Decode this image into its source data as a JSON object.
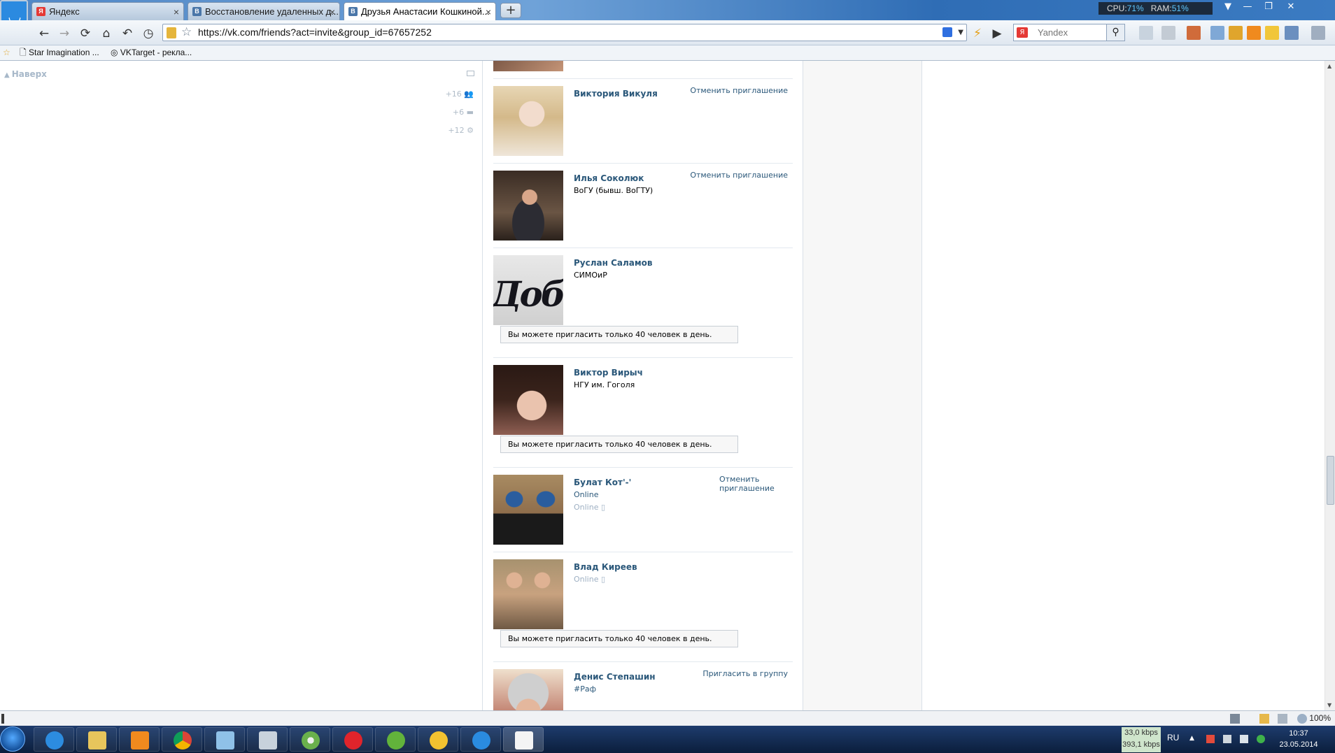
{
  "browser": {
    "tabs": [
      {
        "label": "Яндекс",
        "favicon": "Я",
        "favicon_color": "#e53935",
        "active": false
      },
      {
        "label": "Восстановление удаленных д...",
        "favicon": "В",
        "favicon_color": "#4a76a8",
        "active": false
      },
      {
        "label": "Друзья Анастасии Кошкиной...",
        "favicon": "В",
        "favicon_color": "#4a76a8",
        "active": true
      }
    ],
    "new_tab": "+",
    "sysmon": {
      "cpu_label": "CPU:",
      "cpu_value": "71%",
      "ram_label": "RAM:",
      "ram_value": "51%"
    },
    "url": "https://vk.com/friends?act=invite&group_id=67657252",
    "search_placeholder": "Yandex",
    "bookmarks": [
      {
        "label": "Star Imagination ..."
      },
      {
        "label": "VKTarget - рекла..."
      }
    ],
    "zoom": "100%"
  },
  "sidebar": {
    "to_top": "Наверх",
    "counts": [
      "+16",
      "+6",
      "+12"
    ]
  },
  "friends": [
    {
      "name": "Виктория Викуля",
      "sub": "",
      "action": "Отменить приглашение"
    },
    {
      "name": "Илья Соколюк",
      "sub": "ВоГУ (бывш. ВоГТУ)",
      "action": "Отменить приглашение"
    },
    {
      "name": "Руслан Саламов",
      "sub": "СИМОиР",
      "notice": "Вы можете пригласить только 40 человек в день."
    },
    {
      "name": "Виктор Вирыч",
      "sub": "НГУ им. Гоголя",
      "notice": "Вы можете пригласить только 40 человек в день."
    },
    {
      "name": "Булат Кот'-'",
      "status1": "Online",
      "status2": "Online",
      "action": "Отменить приглашение"
    },
    {
      "name": "Влад Киреев",
      "status2": "Online",
      "notice": "Вы можете пригласить только 40 человек в день."
    },
    {
      "name": "Денис Степашин",
      "sub": "#Раф",
      "action": "Пригласить в группу"
    }
  ],
  "avatar_logo_text": "Добро",
  "taskbar": {
    "net_up": "33,0 kbps",
    "net_down": "393,1 kbps",
    "lang": "RU",
    "time": "10:37",
    "date": "23.05.2014"
  }
}
